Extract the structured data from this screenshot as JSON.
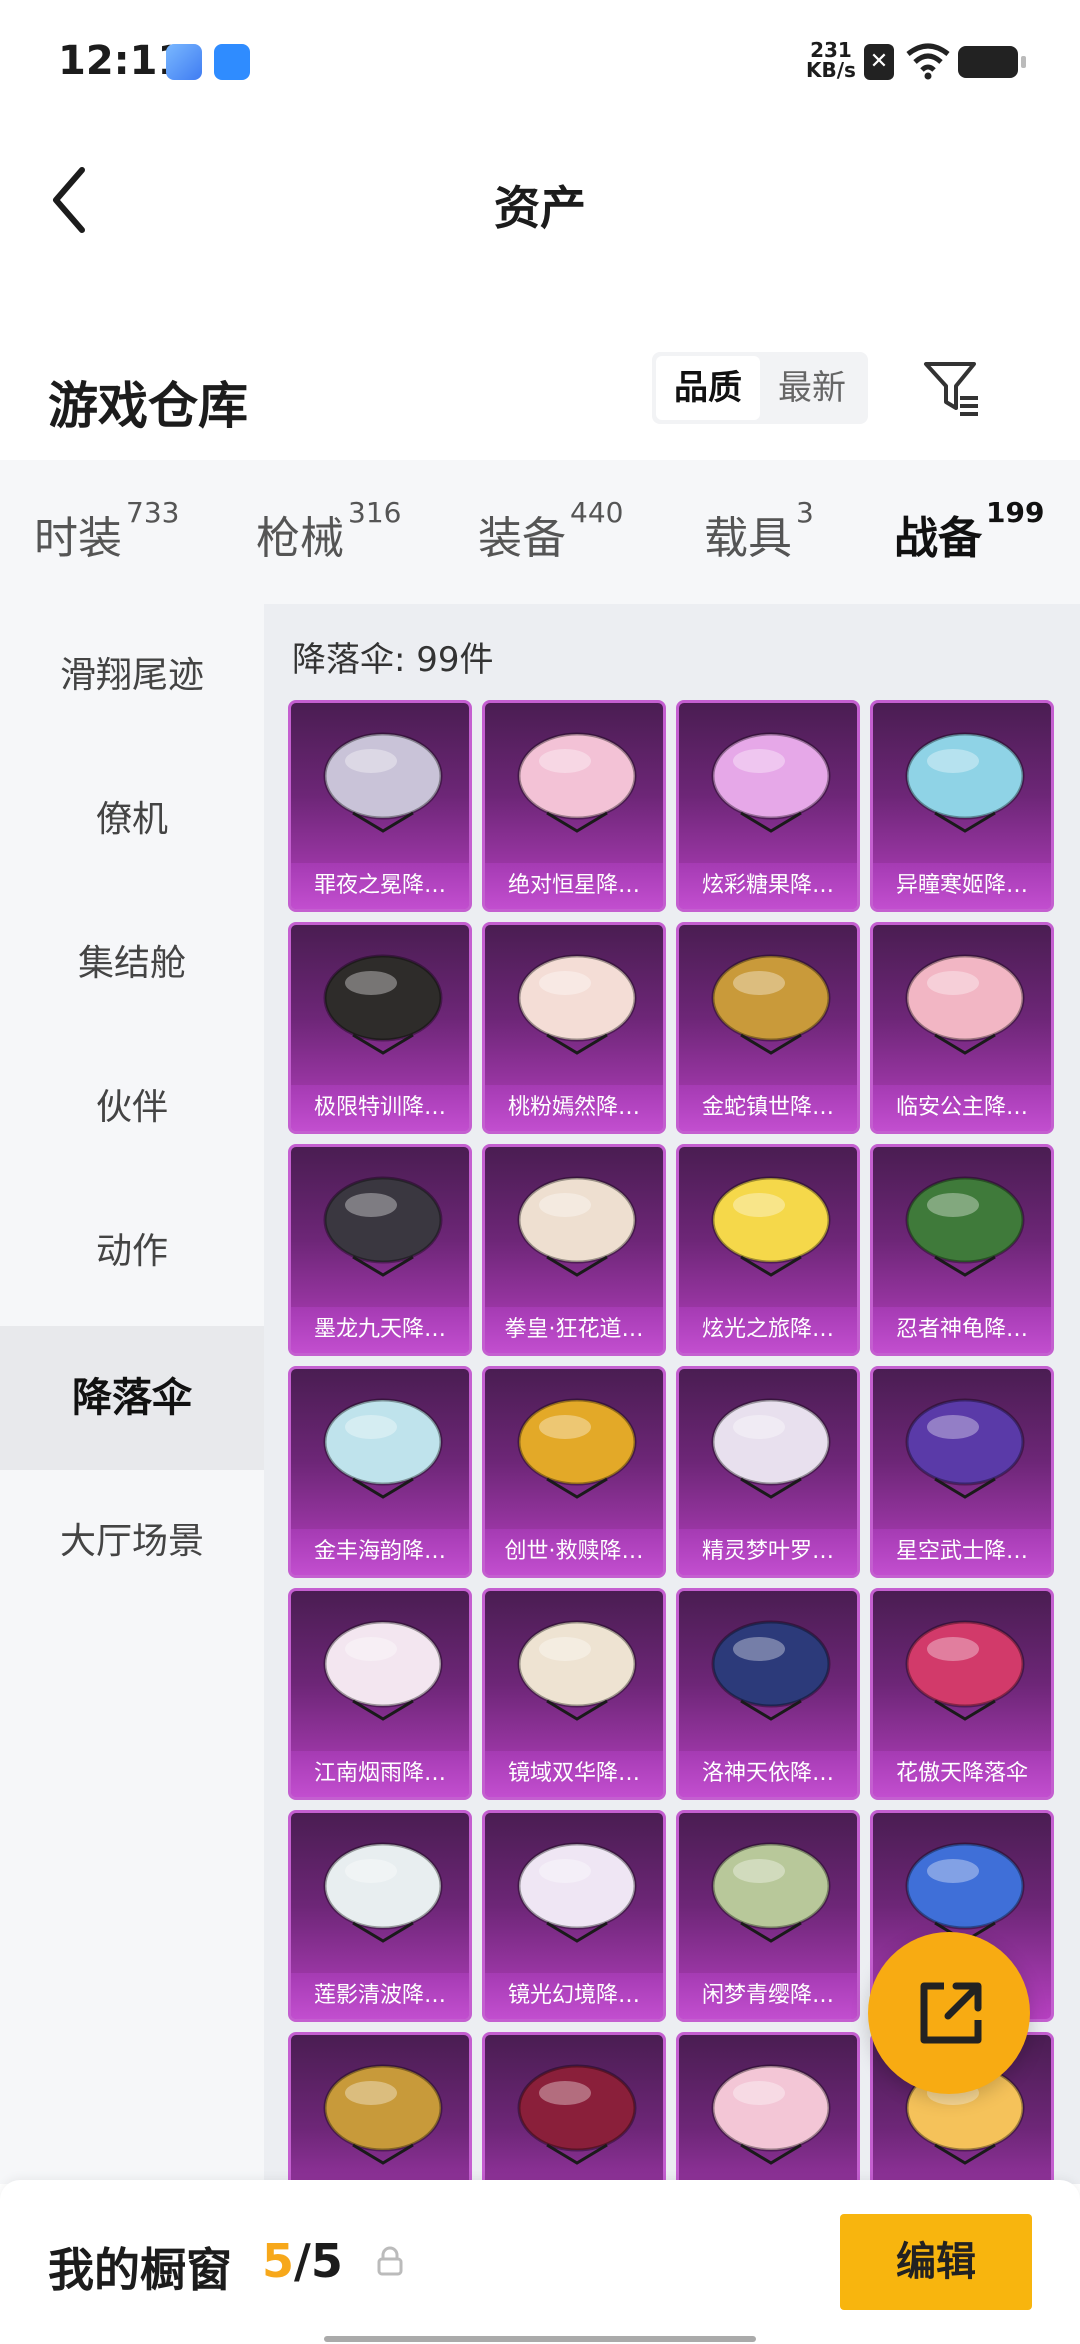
{
  "status_bar": {
    "time": "12:11",
    "speed_value": "231",
    "speed_unit": "KB/s"
  },
  "nav": {
    "title": "资产"
  },
  "header": {
    "title": "游戏仓库",
    "sort_options": [
      "品质",
      "最新"
    ],
    "sort_selected": "品质"
  },
  "tabs": [
    {
      "label": "时装",
      "count": "733"
    },
    {
      "label": "枪械",
      "count": "316"
    },
    {
      "label": "装备",
      "count": "440"
    },
    {
      "label": "载具",
      "count": "3"
    },
    {
      "label": "战备",
      "count": "199"
    }
  ],
  "active_tab": "战备",
  "sidebar": {
    "items": [
      {
        "label": "滑翔尾迹"
      },
      {
        "label": "僚机"
      },
      {
        "label": "集结舱"
      },
      {
        "label": "伙伴"
      },
      {
        "label": "动作"
      },
      {
        "label": "降落伞"
      },
      {
        "label": "大厅场景"
      }
    ],
    "selected": "降落伞"
  },
  "main": {
    "count_text": "降落伞: 99件",
    "items": [
      {
        "name": "罪夜之冕降…",
        "color": "#c9c3d8"
      },
      {
        "name": "绝对恒星降…",
        "color": "#f3c2d6"
      },
      {
        "name": "炫彩糖果降…",
        "color": "#e6a8e8"
      },
      {
        "name": "异瞳寒姬降…",
        "color": "#8fd3e6"
      },
      {
        "name": "极限特训降…",
        "color": "#2e2c2a"
      },
      {
        "name": "桃粉嫣然降…",
        "color": "#f4ddd6"
      },
      {
        "name": "金蛇镇世降…",
        "color": "#c99a3a"
      },
      {
        "name": "临安公主降…",
        "color": "#f2b6c4"
      },
      {
        "name": "墨龙九天降…",
        "color": "#3a3740"
      },
      {
        "name": "拳皇·狂花道…",
        "color": "#eedfd0"
      },
      {
        "name": "炫光之旅降…",
        "color": "#f5d84a"
      },
      {
        "name": "忍者神龟降…",
        "color": "#3f7a3a"
      },
      {
        "name": "金丰海韵降…",
        "color": "#bfe3ec"
      },
      {
        "name": "创世·救赎降…",
        "color": "#e3a928"
      },
      {
        "name": "精灵梦叶罗…",
        "color": "#e8e0ee"
      },
      {
        "name": "星空武士降…",
        "color": "#5a3aa8"
      },
      {
        "name": "江南烟雨降…",
        "color": "#f3e6f0"
      },
      {
        "name": "镜域双华降…",
        "color": "#eee3d2"
      },
      {
        "name": "洛神天依降…",
        "color": "#2c3a7a"
      },
      {
        "name": "花傲天降落伞",
        "color": "#d23a6a"
      },
      {
        "name": "莲影清波降…",
        "color": "#e8eef0"
      },
      {
        "name": "镜光幻境降…",
        "color": "#efe6f4"
      },
      {
        "name": "闲梦青缨降…",
        "color": "#b8c89a"
      },
      {
        "name": "",
        "color": "#3f6fd8"
      },
      {
        "name": "",
        "color": "#c89a3a"
      },
      {
        "name": "",
        "color": "#8a1f3a"
      },
      {
        "name": "",
        "color": "#f3c6d6"
      },
      {
        "name": "",
        "color": "#f5c25a"
      }
    ]
  },
  "footer": {
    "label": "我的橱窗",
    "count_current": "5",
    "count_sep": "/",
    "count_total": "5",
    "edit_label": "编辑"
  }
}
